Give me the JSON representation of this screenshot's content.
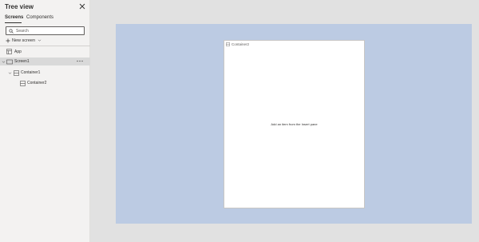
{
  "tree_view": {
    "title": "Tree view",
    "tabs": [
      {
        "label": "Screens",
        "active": true
      },
      {
        "label": "Components",
        "active": false
      }
    ],
    "search": {
      "placeholder": "Search",
      "value": ""
    },
    "new_screen_label": "New screen",
    "items": [
      {
        "label": "App",
        "icon": "app-icon",
        "selected": false
      },
      {
        "label": "Screen1",
        "icon": "screen-icon",
        "selected": true
      },
      {
        "label": "Container1",
        "icon": "container-icon",
        "selected": false
      },
      {
        "label": "Container2",
        "icon": "container-icon",
        "selected": false
      }
    ]
  },
  "canvas": {
    "container_label": "Container2",
    "empty_hint": "Add an item from the Insert pane"
  },
  "colors": {
    "pane_bg": "#f3f2f1",
    "canvas_bg": "#bccbe3",
    "workspace_bg": "#e1e1e1",
    "selected_row": "#d9d9d9"
  }
}
